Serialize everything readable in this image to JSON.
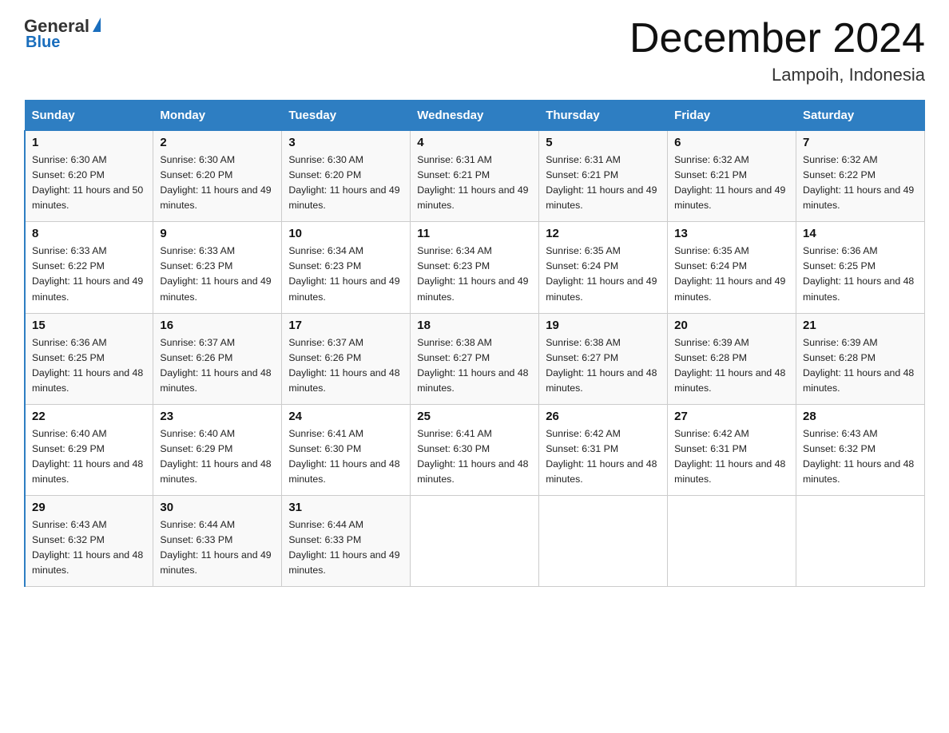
{
  "header": {
    "logo_general": "General",
    "logo_blue": "Blue",
    "month_title": "December 2024",
    "location": "Lampoih, Indonesia"
  },
  "days_of_week": [
    "Sunday",
    "Monday",
    "Tuesday",
    "Wednesday",
    "Thursday",
    "Friday",
    "Saturday"
  ],
  "weeks": [
    [
      {
        "day": "1",
        "sunrise": "Sunrise: 6:30 AM",
        "sunset": "Sunset: 6:20 PM",
        "daylight": "Daylight: 11 hours and 50 minutes."
      },
      {
        "day": "2",
        "sunrise": "Sunrise: 6:30 AM",
        "sunset": "Sunset: 6:20 PM",
        "daylight": "Daylight: 11 hours and 49 minutes."
      },
      {
        "day": "3",
        "sunrise": "Sunrise: 6:30 AM",
        "sunset": "Sunset: 6:20 PM",
        "daylight": "Daylight: 11 hours and 49 minutes."
      },
      {
        "day": "4",
        "sunrise": "Sunrise: 6:31 AM",
        "sunset": "Sunset: 6:21 PM",
        "daylight": "Daylight: 11 hours and 49 minutes."
      },
      {
        "day": "5",
        "sunrise": "Sunrise: 6:31 AM",
        "sunset": "Sunset: 6:21 PM",
        "daylight": "Daylight: 11 hours and 49 minutes."
      },
      {
        "day": "6",
        "sunrise": "Sunrise: 6:32 AM",
        "sunset": "Sunset: 6:21 PM",
        "daylight": "Daylight: 11 hours and 49 minutes."
      },
      {
        "day": "7",
        "sunrise": "Sunrise: 6:32 AM",
        "sunset": "Sunset: 6:22 PM",
        "daylight": "Daylight: 11 hours and 49 minutes."
      }
    ],
    [
      {
        "day": "8",
        "sunrise": "Sunrise: 6:33 AM",
        "sunset": "Sunset: 6:22 PM",
        "daylight": "Daylight: 11 hours and 49 minutes."
      },
      {
        "day": "9",
        "sunrise": "Sunrise: 6:33 AM",
        "sunset": "Sunset: 6:23 PM",
        "daylight": "Daylight: 11 hours and 49 minutes."
      },
      {
        "day": "10",
        "sunrise": "Sunrise: 6:34 AM",
        "sunset": "Sunset: 6:23 PM",
        "daylight": "Daylight: 11 hours and 49 minutes."
      },
      {
        "day": "11",
        "sunrise": "Sunrise: 6:34 AM",
        "sunset": "Sunset: 6:23 PM",
        "daylight": "Daylight: 11 hours and 49 minutes."
      },
      {
        "day": "12",
        "sunrise": "Sunrise: 6:35 AM",
        "sunset": "Sunset: 6:24 PM",
        "daylight": "Daylight: 11 hours and 49 minutes."
      },
      {
        "day": "13",
        "sunrise": "Sunrise: 6:35 AM",
        "sunset": "Sunset: 6:24 PM",
        "daylight": "Daylight: 11 hours and 49 minutes."
      },
      {
        "day": "14",
        "sunrise": "Sunrise: 6:36 AM",
        "sunset": "Sunset: 6:25 PM",
        "daylight": "Daylight: 11 hours and 48 minutes."
      }
    ],
    [
      {
        "day": "15",
        "sunrise": "Sunrise: 6:36 AM",
        "sunset": "Sunset: 6:25 PM",
        "daylight": "Daylight: 11 hours and 48 minutes."
      },
      {
        "day": "16",
        "sunrise": "Sunrise: 6:37 AM",
        "sunset": "Sunset: 6:26 PM",
        "daylight": "Daylight: 11 hours and 48 minutes."
      },
      {
        "day": "17",
        "sunrise": "Sunrise: 6:37 AM",
        "sunset": "Sunset: 6:26 PM",
        "daylight": "Daylight: 11 hours and 48 minutes."
      },
      {
        "day": "18",
        "sunrise": "Sunrise: 6:38 AM",
        "sunset": "Sunset: 6:27 PM",
        "daylight": "Daylight: 11 hours and 48 minutes."
      },
      {
        "day": "19",
        "sunrise": "Sunrise: 6:38 AM",
        "sunset": "Sunset: 6:27 PM",
        "daylight": "Daylight: 11 hours and 48 minutes."
      },
      {
        "day": "20",
        "sunrise": "Sunrise: 6:39 AM",
        "sunset": "Sunset: 6:28 PM",
        "daylight": "Daylight: 11 hours and 48 minutes."
      },
      {
        "day": "21",
        "sunrise": "Sunrise: 6:39 AM",
        "sunset": "Sunset: 6:28 PM",
        "daylight": "Daylight: 11 hours and 48 minutes."
      }
    ],
    [
      {
        "day": "22",
        "sunrise": "Sunrise: 6:40 AM",
        "sunset": "Sunset: 6:29 PM",
        "daylight": "Daylight: 11 hours and 48 minutes."
      },
      {
        "day": "23",
        "sunrise": "Sunrise: 6:40 AM",
        "sunset": "Sunset: 6:29 PM",
        "daylight": "Daylight: 11 hours and 48 minutes."
      },
      {
        "day": "24",
        "sunrise": "Sunrise: 6:41 AM",
        "sunset": "Sunset: 6:30 PM",
        "daylight": "Daylight: 11 hours and 48 minutes."
      },
      {
        "day": "25",
        "sunrise": "Sunrise: 6:41 AM",
        "sunset": "Sunset: 6:30 PM",
        "daylight": "Daylight: 11 hours and 48 minutes."
      },
      {
        "day": "26",
        "sunrise": "Sunrise: 6:42 AM",
        "sunset": "Sunset: 6:31 PM",
        "daylight": "Daylight: 11 hours and 48 minutes."
      },
      {
        "day": "27",
        "sunrise": "Sunrise: 6:42 AM",
        "sunset": "Sunset: 6:31 PM",
        "daylight": "Daylight: 11 hours and 48 minutes."
      },
      {
        "day": "28",
        "sunrise": "Sunrise: 6:43 AM",
        "sunset": "Sunset: 6:32 PM",
        "daylight": "Daylight: 11 hours and 48 minutes."
      }
    ],
    [
      {
        "day": "29",
        "sunrise": "Sunrise: 6:43 AM",
        "sunset": "Sunset: 6:32 PM",
        "daylight": "Daylight: 11 hours and 48 minutes."
      },
      {
        "day": "30",
        "sunrise": "Sunrise: 6:44 AM",
        "sunset": "Sunset: 6:33 PM",
        "daylight": "Daylight: 11 hours and 49 minutes."
      },
      {
        "day": "31",
        "sunrise": "Sunrise: 6:44 AM",
        "sunset": "Sunset: 6:33 PM",
        "daylight": "Daylight: 11 hours and 49 minutes."
      },
      null,
      null,
      null,
      null
    ]
  ]
}
